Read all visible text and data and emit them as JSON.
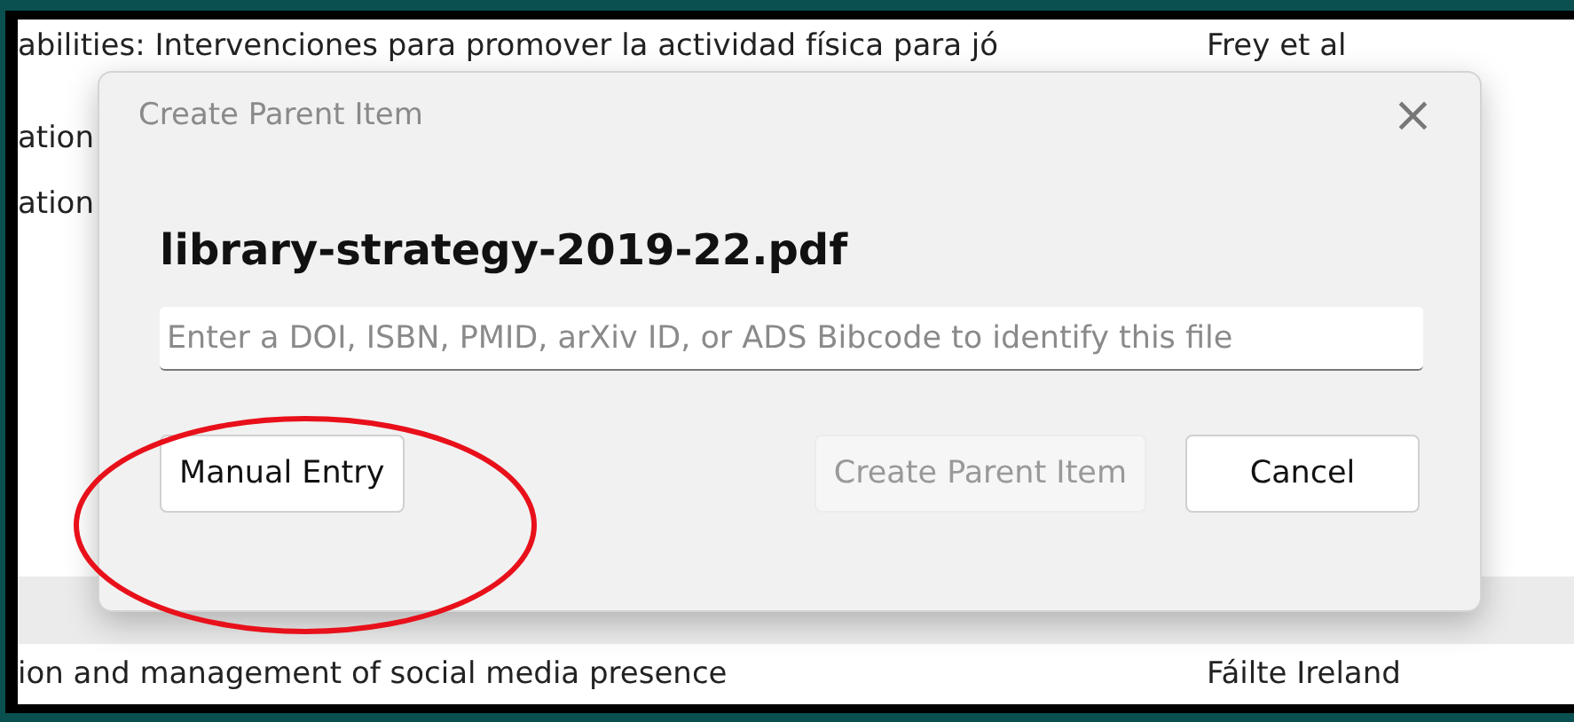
{
  "list": {
    "rows": [
      {
        "title": "abilities: Intervenciones para promover la actividad física para jó",
        "creator": "Frey et al",
        "selected": false
      },
      {
        "title": "ation",
        "selected": false
      },
      {
        "title": "ation",
        "selected": false
      },
      {
        "selected": true
      },
      {
        "title": "ion and management of social media presence",
        "creator": "Fáilte Ireland",
        "selected": false
      }
    ]
  },
  "dialog": {
    "title": "Create Parent Item",
    "close": "×",
    "filename": "library-strategy-2019-22.pdf",
    "field": {
      "placeholder": "Enter a DOI, ISBN, PMID, arXiv ID, or ADS Bibcode to identify this file"
    },
    "buttons": [
      {
        "label": "Manual Entry",
        "disabled": false
      },
      {
        "label": "Create Parent Item",
        "disabled": true
      },
      {
        "label": "Cancel",
        "disabled": false
      }
    ]
  },
  "annotation": {
    "kind": "ellipse",
    "color": "#e8101a"
  }
}
